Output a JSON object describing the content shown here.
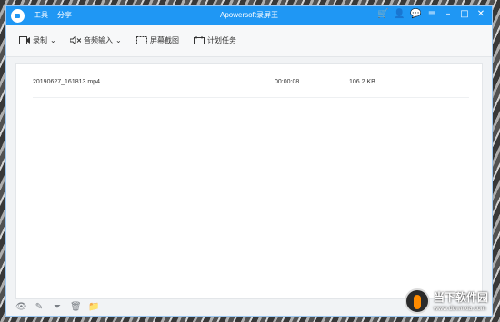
{
  "window": {
    "title": "Apowersoft录屏王",
    "menu": [
      "工具",
      "分享"
    ]
  },
  "toolbar": {
    "record_label": "录制",
    "audio_label": "音频输入",
    "screenshot_label": "屏幕截图",
    "schedule_label": "计划任务"
  },
  "file_list": {
    "rows": [
      {
        "name": "20190627_161813.mp4",
        "duration": "00:00:08",
        "size": "106.2 KB"
      }
    ]
  },
  "watermark": {
    "text": "当下软件园",
    "url": "www.downxia.com"
  },
  "icons": {
    "title_right": [
      "cart-icon",
      "user-icon",
      "chat-icon",
      "menu-icon",
      "minimize-icon",
      "maximize-icon",
      "close-icon"
    ],
    "bottom": [
      "eye-icon",
      "pencil-icon",
      "filter-icon",
      "trash-icon",
      "folder-icon"
    ]
  },
  "colors": {
    "titlebar": "#1f97f4",
    "window_bg": "#f1f3f5",
    "panel_bg": "#ffffff"
  }
}
